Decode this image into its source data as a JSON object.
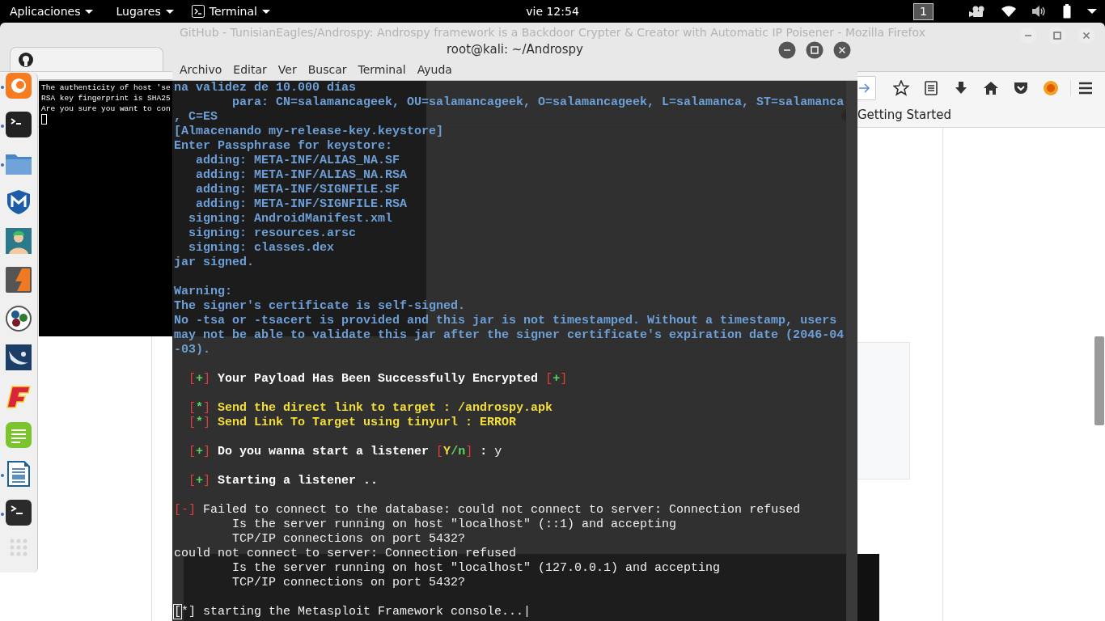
{
  "top_bar": {
    "menus": [
      {
        "label": "Aplicaciones"
      },
      {
        "label": "Lugares"
      },
      {
        "label": "Terminal"
      }
    ],
    "clock": "vie 12:54",
    "workspace": "1"
  },
  "dock": {
    "items": [
      {
        "running": true
      },
      {
        "running": true
      },
      {
        "running": true
      },
      {
        "running": false
      },
      {
        "running": false
      },
      {
        "running": false
      },
      {
        "running": false
      },
      {
        "running": false
      },
      {
        "running": false
      },
      {
        "running": false
      },
      {
        "running": true
      },
      {
        "running": true
      }
    ]
  },
  "browser": {
    "title": "GitHub - TunisianEagles/Androspy: Androspy framework is a Backdoor Crypter & Creator with Automatic IP Poisener - Mozilla Firefox",
    "bookmarks": [
      {
        "label": "Getting Started"
      }
    ]
  },
  "ssh_window": {
    "lines": [
      "The authenticity of host 'se",
      "RSA key fingerprint is SHA25",
      "Are you sure you want to con"
    ]
  },
  "terminal": {
    "title": "root@kali: ~/Androspy",
    "menu": [
      "Archivo",
      "Editar",
      "Ver",
      "Buscar",
      "Terminal",
      "Ayuda"
    ],
    "lines": [
      {
        "kind": "text",
        "segments": [
          {
            "text": "na validez de 10.000 días",
            "kind": "info"
          }
        ]
      },
      {
        "kind": "text",
        "segments": [
          {
            "text": "        para: CN=salamancageek, OU=salamancageek, O=salamancageek, L=salamanca, ST=salamanca",
            "kind": "info"
          }
        ]
      },
      {
        "kind": "text",
        "segments": [
          {
            "text": ", C=ES",
            "kind": "info"
          }
        ]
      },
      {
        "kind": "text",
        "segments": [
          {
            "text": "[Almacenando my-release-key.keystore]",
            "kind": "info"
          }
        ]
      },
      {
        "kind": "text",
        "segments": [
          {
            "text": "Enter Passphrase for keystore:",
            "kind": "info"
          }
        ]
      },
      {
        "kind": "text",
        "segments": [
          {
            "text": "   adding: META-INF/ALIAS_NA.SF",
            "kind": "info"
          }
        ]
      },
      {
        "kind": "text",
        "segments": [
          {
            "text": "   adding: META-INF/ALIAS_NA.RSA",
            "kind": "info"
          }
        ]
      },
      {
        "kind": "text",
        "segments": [
          {
            "text": "   adding: META-INF/SIGNFILE.SF",
            "kind": "info"
          }
        ]
      },
      {
        "kind": "text",
        "segments": [
          {
            "text": "   adding: META-INF/SIGNFILE.RSA",
            "kind": "info"
          }
        ]
      },
      {
        "kind": "text",
        "segments": [
          {
            "text": "  signing: AndroidManifest.xml",
            "kind": "info"
          }
        ]
      },
      {
        "kind": "text",
        "segments": [
          {
            "text": "  signing: resources.arsc",
            "kind": "info"
          }
        ]
      },
      {
        "kind": "text",
        "segments": [
          {
            "text": "  signing: classes.dex",
            "kind": "info"
          }
        ]
      },
      {
        "kind": "text",
        "segments": [
          {
            "text": "jar signed.",
            "kind": "info"
          }
        ]
      },
      {
        "kind": "blank"
      },
      {
        "kind": "text",
        "segments": [
          {
            "text": "Warning:",
            "kind": "info"
          }
        ]
      },
      {
        "kind": "text",
        "segments": [
          {
            "text": "The signer's certificate is self-signed.",
            "kind": "info"
          }
        ]
      },
      {
        "kind": "text",
        "segments": [
          {
            "text": "No -tsa or -tsacert is provided and this jar is not timestamped. Without a timestamp, users",
            "kind": "info"
          }
        ]
      },
      {
        "kind": "text",
        "segments": [
          {
            "text": "may not be able to validate this jar after the signer certificate's expiration date (2046-04",
            "kind": "info"
          }
        ]
      },
      {
        "kind": "text",
        "segments": [
          {
            "text": "-03).",
            "kind": "info"
          }
        ]
      },
      {
        "kind": "blank"
      },
      {
        "kind": "text",
        "segments": [
          {
            "text": "  [",
            "kind": "bracket"
          },
          {
            "text": "+",
            "kind": "mark"
          },
          {
            "text": "]",
            "kind": "bracket"
          },
          {
            "text": " Your Payload Has Been Successfully Encrypted ",
            "kind": "bold"
          },
          {
            "text": "[",
            "kind": "bracket"
          },
          {
            "text": "+",
            "kind": "mark"
          },
          {
            "text": "]",
            "kind": "bracket"
          }
        ]
      },
      {
        "kind": "blank"
      },
      {
        "kind": "text",
        "segments": [
          {
            "text": "  [",
            "kind": "bracket"
          },
          {
            "text": "*",
            "kind": "mark"
          },
          {
            "text": "]",
            "kind": "bracket"
          },
          {
            "text": " Send the direct link to target : /androspy.apk",
            "kind": "alert"
          }
        ]
      },
      {
        "kind": "text",
        "segments": [
          {
            "text": "  [",
            "kind": "bracket"
          },
          {
            "text": "*",
            "kind": "mark"
          },
          {
            "text": "]",
            "kind": "bracket"
          },
          {
            "text": " Send Link To Target using tinyurl : ERROR",
            "kind": "alert"
          }
        ]
      },
      {
        "kind": "blank"
      },
      {
        "kind": "text",
        "segments": [
          {
            "text": "  [",
            "kind": "bracket"
          },
          {
            "text": "+",
            "kind": "mark"
          },
          {
            "text": "]",
            "kind": "bracket"
          },
          {
            "text": " Do you wanna start a listener ",
            "kind": "bold"
          },
          {
            "text": "[",
            "kind": "bracket"
          },
          {
            "text": "Y",
            "kind": "alert"
          },
          {
            "text": "/n",
            "kind": "mark"
          },
          {
            "text": "]",
            "kind": "bracket"
          },
          {
            "text": " :",
            "kind": "bold"
          },
          {
            "text": " y",
            "kind": "plain"
          }
        ]
      },
      {
        "kind": "blank"
      },
      {
        "kind": "text",
        "segments": [
          {
            "text": "  [",
            "kind": "bracket"
          },
          {
            "text": "+",
            "kind": "mark"
          },
          {
            "text": "]",
            "kind": "bracket"
          },
          {
            "text": " Starting a listener ..",
            "kind": "bold"
          }
        ]
      },
      {
        "kind": "blank"
      },
      {
        "kind": "text",
        "segments": [
          {
            "text": "[-]",
            "kind": "bracket"
          },
          {
            "text": " Failed to connect to the database: could not connect to server: Connection refused",
            "kind": "plain"
          }
        ]
      },
      {
        "kind": "text",
        "segments": [
          {
            "text": "        Is the server running on host \"localhost\" (::1) and accepting",
            "kind": "plain"
          }
        ]
      },
      {
        "kind": "text",
        "segments": [
          {
            "text": "        TCP/IP connections on port 5432?",
            "kind": "plain"
          }
        ]
      },
      {
        "kind": "text",
        "segments": [
          {
            "text": "could not connect to server: Connection refused",
            "kind": "plain"
          }
        ]
      },
      {
        "kind": "text",
        "segments": [
          {
            "text": "        Is the server running on host \"localhost\" (127.0.0.1) and accepting",
            "kind": "plain"
          }
        ]
      },
      {
        "kind": "text",
        "segments": [
          {
            "text": "        TCP/IP connections on port 5432?",
            "kind": "plain"
          }
        ]
      },
      {
        "kind": "blank"
      },
      {
        "kind": "text",
        "segments": [
          {
            "text": "[",
            "kind": "cursor"
          },
          {
            "text": "*] starting the Metasploit Framework console...|",
            "kind": "plain"
          }
        ]
      }
    ]
  }
}
